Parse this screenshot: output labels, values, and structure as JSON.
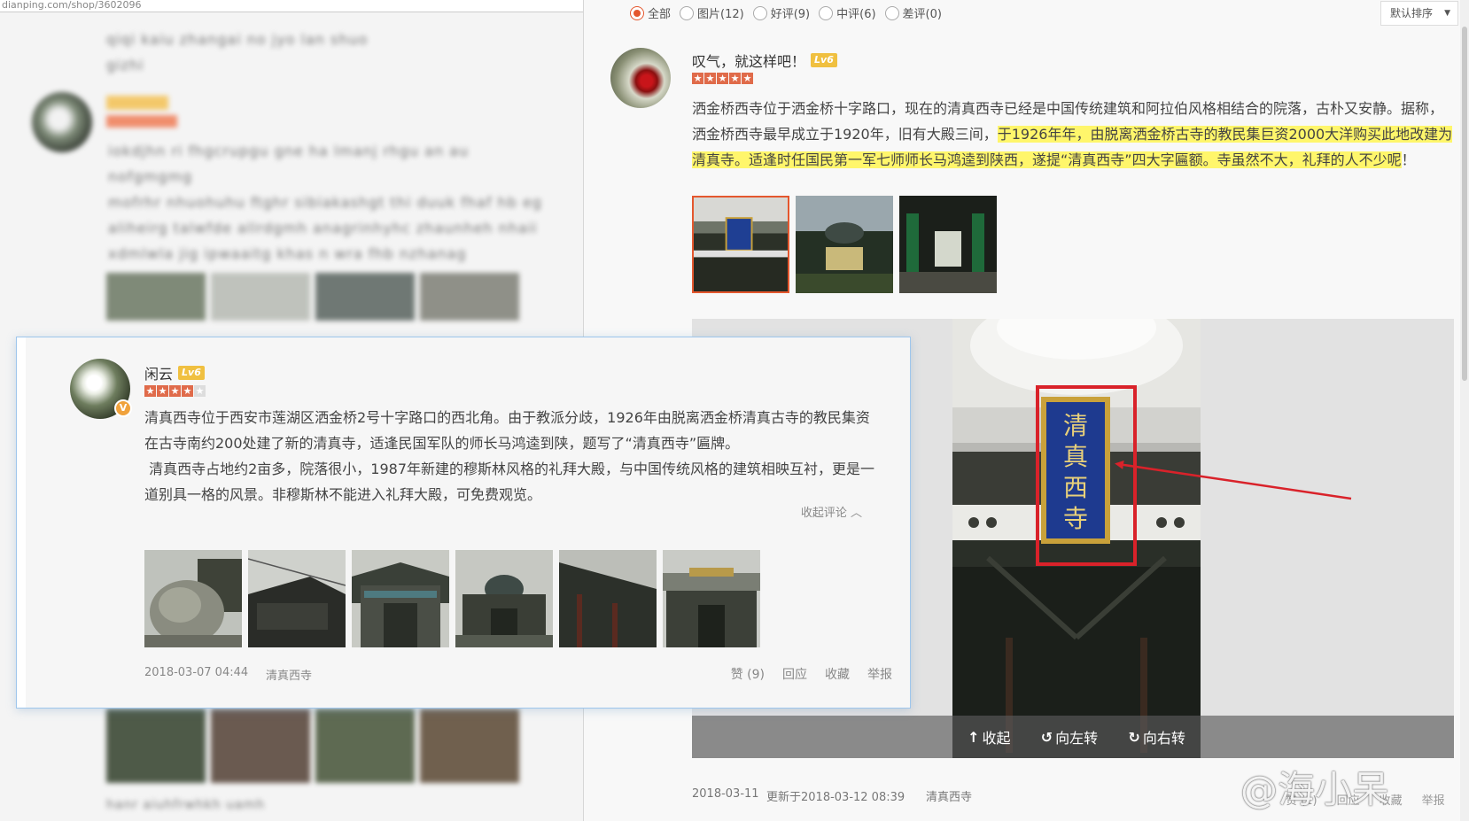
{
  "left_window": {
    "url": "dianping.com/shop/3602096",
    "blurred_text": [
      "qiqi kaiu zhangai no jyo lan shuo gizhi",
      "iokdjhn ri fhgcrupgu gne ha lmanj rhgu an au nofgmgmg",
      "mofrhr nhuohuhu ftghr sibiakashgt thi duuk fhaf hb eg",
      "aliheirg talwfde allrdgmh anagrinhyhc zhaunheh nhaii",
      "xdmlwla jig ipwaaitg khas n wra fhb nzhanag"
    ],
    "blurred_footer": "hanr aiuhfrwhkh  uamh"
  },
  "popup_review": {
    "user_name": "闲云",
    "level": "Lv6",
    "badge": "V",
    "rating": 4,
    "paragraphs": [
      "清真西寺位于西安市莲湖区洒金桥2号十字路口的西北角。由于教派分歧，1926年由脱离洒金桥清真古寺的教民集资在古寺南约200处建了新的清真寺，适逢民国军队的师长马鸿逵到陕，题写了“清真西寺”匾牌。",
      " 清真西寺占地约2亩多，院落很小，1987年新建的穆斯林风格的礼拜大殿，与中国传统风格的建筑相映互衬，更是一道别具一格的风景。非穆斯林不能进入礼拜大殿，可免费观览。"
    ],
    "collapse_label": "收起评论",
    "date": "2018-03-07 04:44",
    "shop": "清真西寺",
    "actions": [
      "赞 (9)",
      "回应",
      "收藏",
      "举报"
    ]
  },
  "right_window": {
    "filters": [
      {
        "label": "全部",
        "selected": true
      },
      {
        "label": "图片(12)",
        "selected": false
      },
      {
        "label": "好评(9)",
        "selected": false
      },
      {
        "label": "中评(6)",
        "selected": false
      },
      {
        "label": "差评(0)",
        "selected": false
      }
    ],
    "sort_label": "默认排序",
    "review": {
      "user_name": "叹气，就这样吧！",
      "level": "Lv6",
      "rating": 5,
      "text_plain_1": "洒金桥西寺位于洒金桥十字路口，现在的清真西寺已经是中国传统建筑和阿拉伯风格相结合的院落，古朴又安静。据称，洒金桥西寺最早成立于1920年，旧有大殿三间，",
      "text_highlight_1": "于1926年年，由脱离洒金桥古寺的教民集巨资2000大洋购买此地改建为清真寺。",
      "text_highlight_2": "适逢时任国民第一军七师师长马鸿逵到陕西，遂提“清真西寺”四大字匾额。寺虽然不大，礼拜的人不少呢",
      "text_plain_2": "！",
      "plaque_text": "清真西寺",
      "viewer_actions": [
        {
          "icon": "↑",
          "label": "收起"
        },
        {
          "icon": "↺",
          "label": "向左转"
        },
        {
          "icon": "↻",
          "label": "向右转"
        }
      ],
      "date": "2018-03-11",
      "updated": "更新于2018-03-12 08:39",
      "shop": "清真西寺",
      "actions": [
        "赞 (1)",
        "回应",
        "收藏",
        "举报"
      ]
    }
  },
  "watermark": "@海小呆",
  "colors": {
    "accent": "#e4572e",
    "highlight": "#fff66b",
    "annotation_red": "#d9222a",
    "popup_border": "#9ec6ec"
  }
}
